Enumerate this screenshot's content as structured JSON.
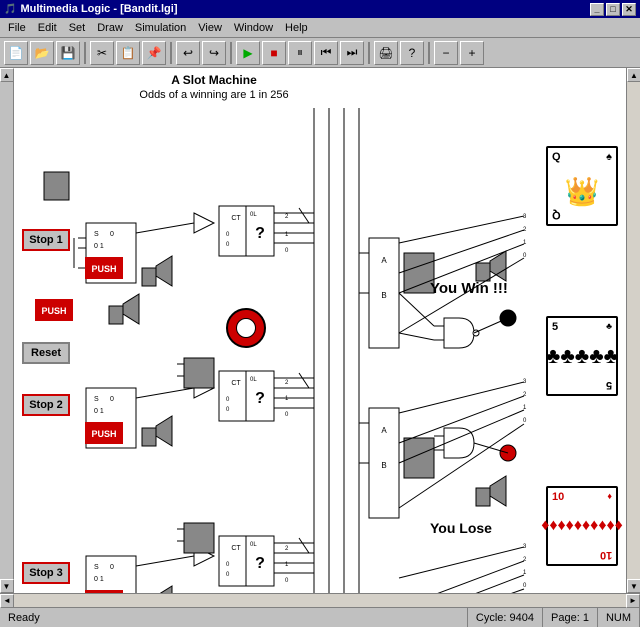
{
  "titleBar": {
    "icon": "🎵",
    "title": "Multimedia Logic - [Bandit.lgi]",
    "controls": [
      "_",
      "□",
      "✕"
    ]
  },
  "menuBar": {
    "items": [
      "File",
      "Edit",
      "Set",
      "Draw",
      "Simulation",
      "View",
      "Window",
      "Help"
    ]
  },
  "toolbar": {
    "buttons": [
      {
        "name": "new",
        "icon": "📄"
      },
      {
        "name": "open",
        "icon": "📂"
      },
      {
        "name": "save",
        "icon": "💾"
      },
      {
        "name": "cut",
        "icon": "✂"
      },
      {
        "name": "copy",
        "icon": "📋"
      },
      {
        "name": "paste",
        "icon": "📌"
      },
      {
        "name": "undo",
        "icon": "↩"
      },
      {
        "name": "redo",
        "icon": "↪"
      },
      {
        "name": "play",
        "icon": "▶"
      },
      {
        "name": "stop",
        "icon": "■"
      },
      {
        "name": "pause",
        "icon": "⏸"
      },
      {
        "name": "rewind",
        "icon": "⏮"
      },
      {
        "name": "forward",
        "icon": "⏭"
      },
      {
        "name": "print",
        "icon": "🖨"
      },
      {
        "name": "help",
        "icon": "?"
      },
      {
        "name": "minus",
        "icon": "−"
      },
      {
        "name": "plus",
        "icon": "+"
      }
    ]
  },
  "canvas": {
    "title": "A Slot Machine",
    "subtitle": "Odds of a winning are 1 in 256",
    "winText": "You Win !!!",
    "loseText": "You Lose"
  },
  "controls": {
    "stop1": "Stop 1",
    "stop2": "Stop 2",
    "stop3": "Stop 3",
    "push": "PUSH",
    "reset": "Reset"
  },
  "statusBar": {
    "ready": "Ready",
    "cycle": "Cycle: 9404",
    "page": "Page: 1",
    "num": "NUM"
  },
  "scrollbar": {
    "upArrow": "▲",
    "downArrow": "▼",
    "leftArrow": "◄",
    "rightArrow": "►"
  }
}
